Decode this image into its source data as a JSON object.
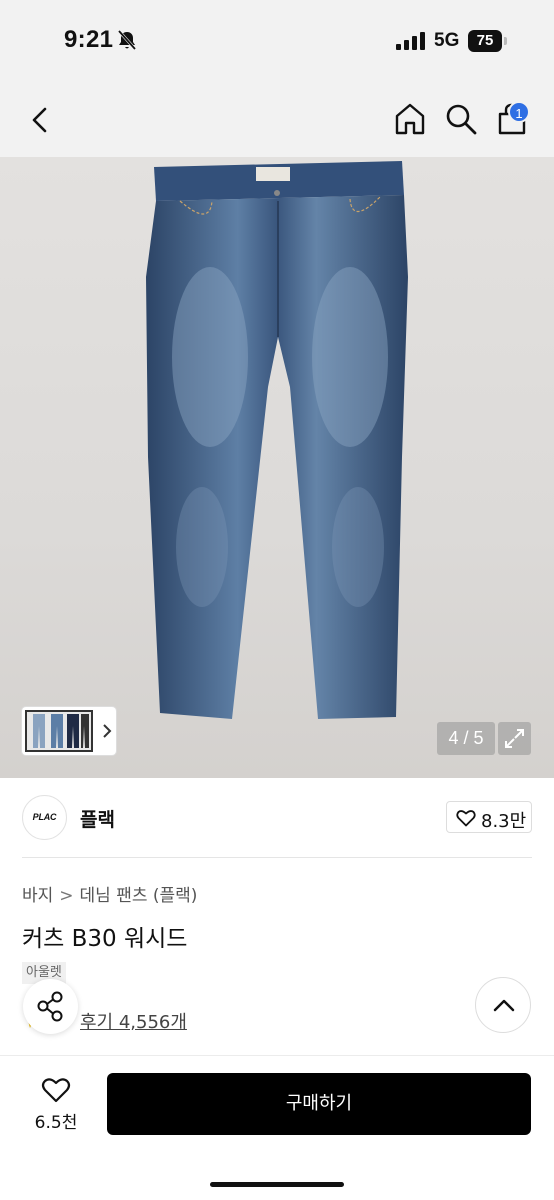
{
  "status_bar": {
    "time": "9:21",
    "network": "5G",
    "battery": "75"
  },
  "header": {
    "cart_count": "1"
  },
  "gallery": {
    "counter": "4 / 5"
  },
  "brand": {
    "logo_text": "PLAC",
    "name": "플랙",
    "likes": "8.3만"
  },
  "breadcrumb": {
    "level1": "바지",
    "separator": ">",
    "level2": "데님 팬츠 (플랙)"
  },
  "product": {
    "title": "커츠 B30 워시드",
    "tag": "아울렛",
    "reviews": "후기 4,556개"
  },
  "bottom_bar": {
    "wish_count": "6.5천",
    "buy_label": "구매하기"
  },
  "colors": {
    "accent_badge": "#2f6fe4",
    "buy_button": "#000000",
    "denim": "#3d5a7f"
  }
}
